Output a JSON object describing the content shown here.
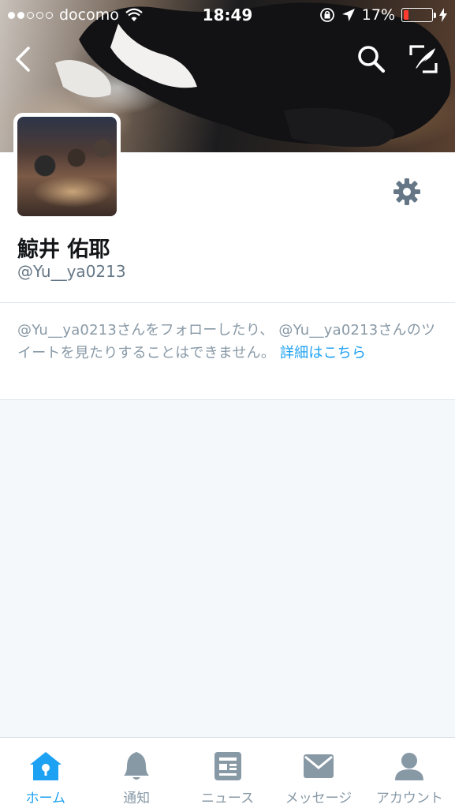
{
  "status_bar": {
    "carrier": "docomo",
    "time": "18:49",
    "battery_percent": "17%"
  },
  "header": {
    "back_icon": "chevron-left-icon",
    "search_icon": "search-icon",
    "compose_icon": "compose-tweet-icon"
  },
  "profile": {
    "display_name": "鯨井 佑耶",
    "handle": "@Yu__ya0213",
    "settings_icon": "gear-icon"
  },
  "notice": {
    "text": "@Yu__ya0213さんをフォローしたり、 @Yu__ya0213さんのツイートを見たりすることはできません。",
    "link": "詳細はこちら"
  },
  "tabs": [
    {
      "label": "ホーム",
      "icon": "home-icon",
      "active": true
    },
    {
      "label": "通知",
      "icon": "bell-icon",
      "active": false
    },
    {
      "label": "ニュース",
      "icon": "news-icon",
      "active": false
    },
    {
      "label": "メッセージ",
      "icon": "envelope-icon",
      "active": false
    },
    {
      "label": "アカウント",
      "icon": "person-icon",
      "active": false
    }
  ],
  "colors": {
    "accent": "#1da1f2",
    "muted": "#8899a6",
    "background": "#f5f8fa",
    "battery_low": "#ff3b30"
  }
}
